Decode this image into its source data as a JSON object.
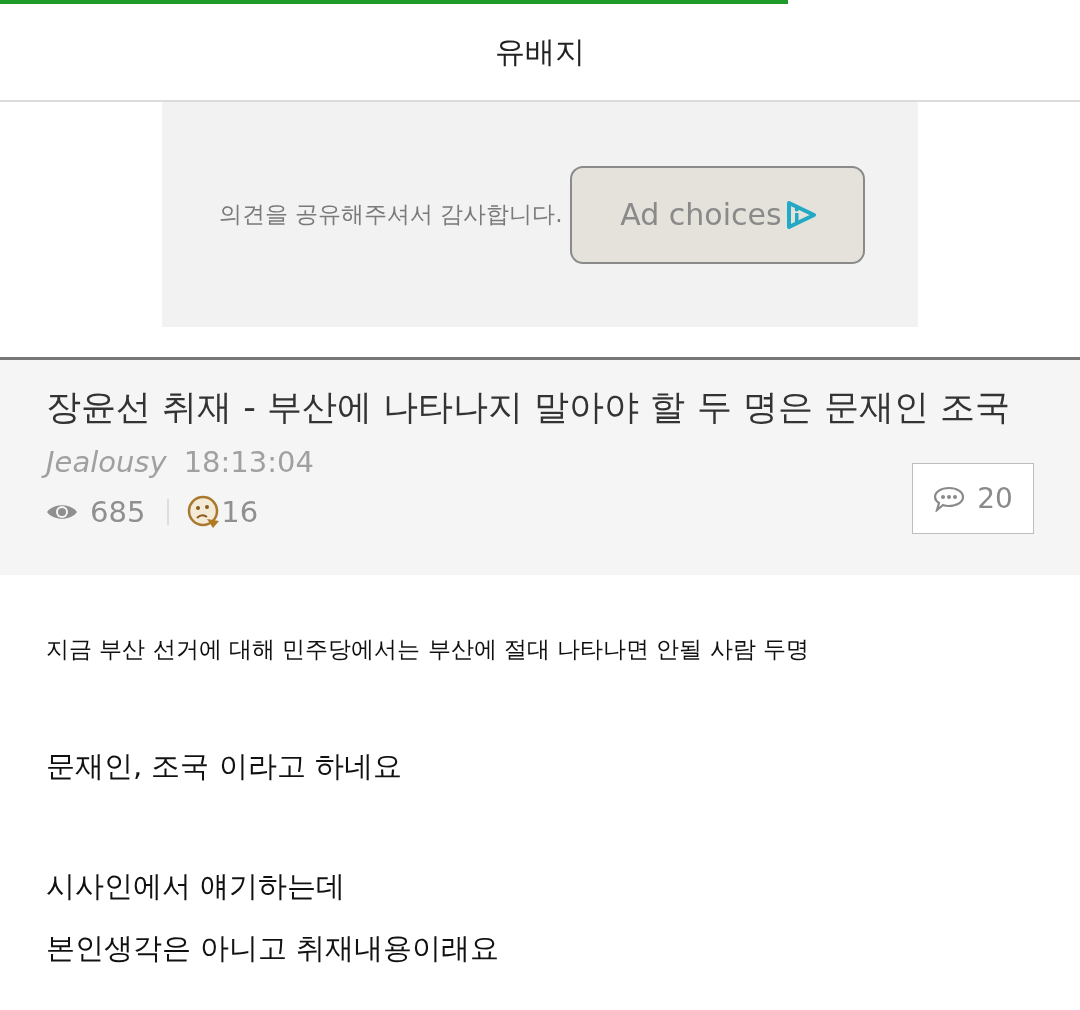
{
  "progress_bar": {
    "level": 0.73
  },
  "header": {
    "title": "유배지"
  },
  "ad": {
    "message": "의견을 공유해주셔서 감사합니다.",
    "button": {
      "label": "Ad choices"
    }
  },
  "post": {
    "title": "장윤선 취재 - 부산에 나타나지 말아야 할 두 명은 문재인 조국",
    "author": "Jealousy",
    "time": "18:13:04",
    "views": "685",
    "reactions": "16",
    "comments": "20"
  },
  "body": {
    "paragraphs": [
      {
        "kind": "small",
        "lines": [
          "지금 부산 선거에 대해 민주당에서는 부산에 절대 나타나면 안될 사람 두명"
        ]
      },
      {
        "kind": "large",
        "lines": [
          "문재인, 조국 이라고 하네요"
        ]
      },
      {
        "kind": "large",
        "lines": [
          "시사인에서 얘기하는데",
          "본인생각은 아니고 취재내용이래요"
        ]
      }
    ]
  }
}
